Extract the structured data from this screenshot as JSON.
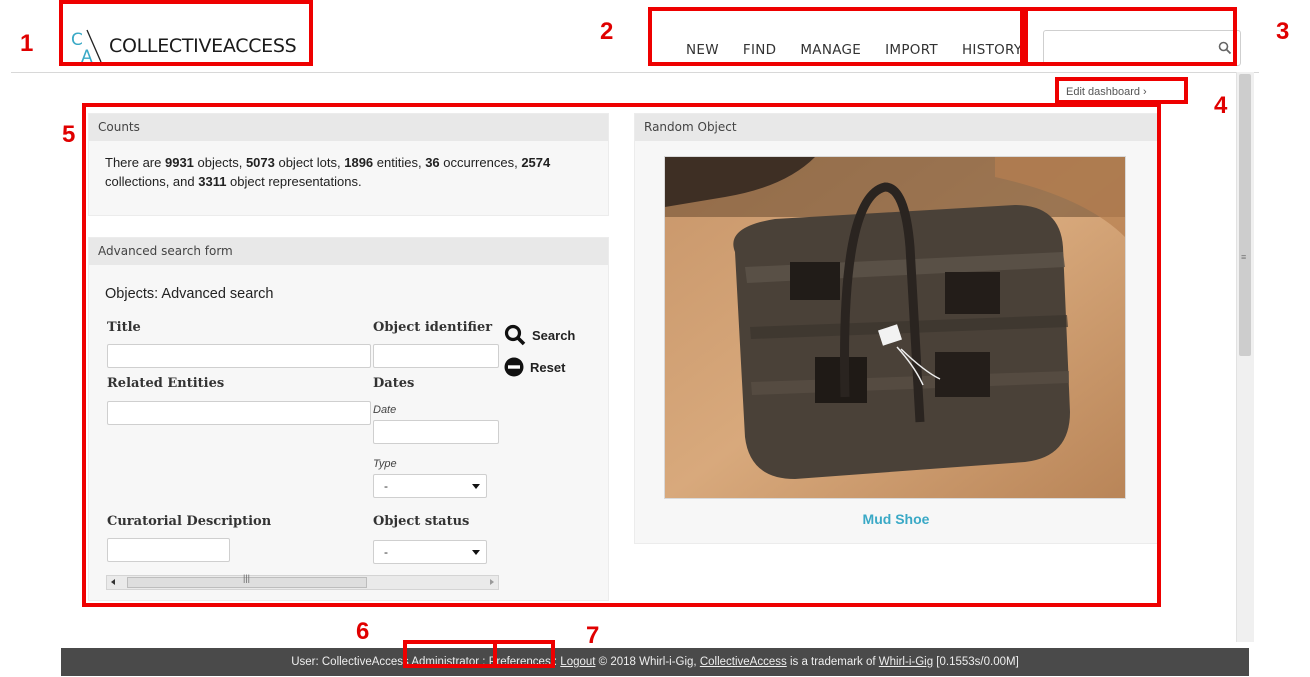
{
  "app": {
    "logo_text": "COLLECTIVEACCESS",
    "nav": [
      "NEW",
      "FIND",
      "MANAGE",
      "IMPORT",
      "HISTORY"
    ],
    "search": {
      "value": "",
      "placeholder": ""
    },
    "edit_dashboard": "Edit dashboard ›"
  },
  "counts": {
    "title": "Counts",
    "p1": "There are ",
    "objects": "9931",
    "p2": " objects, ",
    "lots": "5073",
    "p3": " object lots, ",
    "entities": "1896",
    "p4": " entities, ",
    "occurrences": "36",
    "p5": " occurrences, ",
    "collections": "2574",
    "p6": " collections, and ",
    "representations": "3311",
    "p7": " object representations."
  },
  "advanced_search": {
    "panel_title": "Advanced search form",
    "form_title": "Objects: Advanced search",
    "labels": {
      "title": "Title",
      "object_identifier": "Object identifier",
      "related_entities": "Related Entities",
      "dates": "Dates",
      "date": "Date",
      "type": "Type",
      "curatorial_description": "Curatorial Description",
      "object_status": "Object status"
    },
    "type_select": "-",
    "status_select": "-",
    "search_button": "Search",
    "reset_button": "Reset"
  },
  "random_object": {
    "title": "Random Object",
    "caption": "Mud Shoe"
  },
  "footer": {
    "user_text": "User: CollectiveAccess Administrator : ",
    "preferences": "Preferences",
    "sep": " : ",
    "logout": "Logout",
    "copyright": " © 2018 Whirl-i-Gig, ",
    "ca_link": "CollectiveAccess",
    "trademark": " is a trademark of ",
    "wig_link": "Whirl-i-Gig",
    "timing": " [0.1553s/0.00M]"
  },
  "annotations": [
    "1",
    "2",
    "3",
    "4",
    "5",
    "6",
    "7"
  ],
  "colors": {
    "annotation": "#ee0000",
    "link_accent": "#3aa9c6",
    "footer_bg": "#4a4a4a"
  }
}
